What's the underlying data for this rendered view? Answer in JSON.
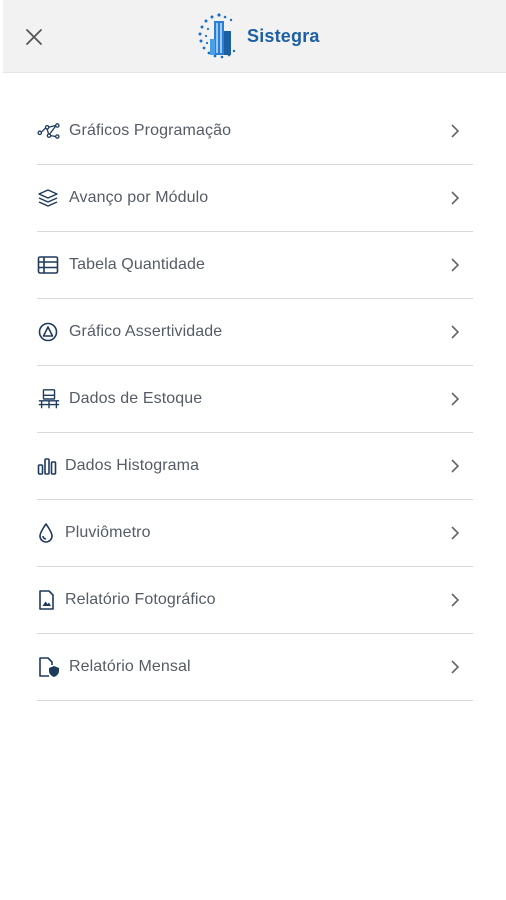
{
  "header": {
    "logo_text": "Sistegra",
    "close_icon": "close-icon"
  },
  "colors": {
    "header_bg": "#f2f2f2",
    "brand": "#1d5fa4",
    "icon": "#1f3b5c",
    "text": "#555c66",
    "divider": "#d8d8d8"
  },
  "menu": {
    "items": [
      {
        "label": "Gráficos Programação",
        "icon": "network-graph-icon"
      },
      {
        "label": "Avanço por Módulo",
        "icon": "layers-icon"
      },
      {
        "label": "Tabela Quantidade",
        "icon": "table-icon"
      },
      {
        "label": "Gráfico Assertividade",
        "icon": "triangle-target-icon"
      },
      {
        "label": "Dados de Estoque",
        "icon": "pallet-box-icon"
      },
      {
        "label": "Dados Histograma",
        "icon": "bar-chart-icon"
      },
      {
        "label": "Pluviômetro",
        "icon": "water-drop-icon"
      },
      {
        "label": "Relatório Fotográfico",
        "icon": "image-file-icon"
      },
      {
        "label": "Relatório Mensal",
        "icon": "file-shield-icon"
      }
    ]
  }
}
